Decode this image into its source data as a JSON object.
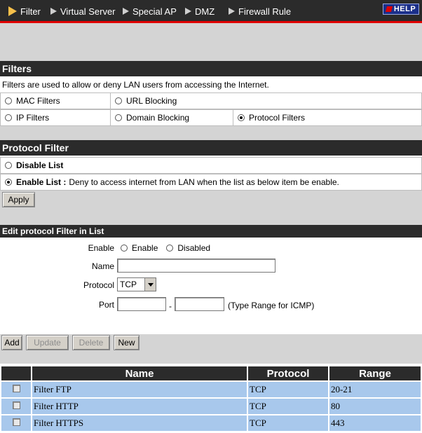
{
  "nav": {
    "items": [
      {
        "label": "Filter"
      },
      {
        "label": "Virtual Server"
      },
      {
        "label": "Special AP"
      },
      {
        "label": "DMZ"
      },
      {
        "label": "Firewall Rule"
      }
    ],
    "help": "HELP"
  },
  "filters": {
    "title": "Filters",
    "description": "Filters are used to allow or deny LAN users from accessing the Internet.",
    "options": {
      "mac": "MAC Filters",
      "url": "URL Blocking",
      "ip": "IP Filters",
      "domain": "Domain Blocking",
      "protocol": "Protocol Filters"
    },
    "selected": "Protocol Filters"
  },
  "protocol_filter": {
    "title": "Protocol Filter",
    "disable_label": "Disable List",
    "enable_label": "Enable List :",
    "enable_desc": "Deny to access internet from LAN when the list as below item be enable.",
    "selected": "Enable List",
    "apply": "Apply"
  },
  "edit": {
    "title": "Edit protocol Filter in List",
    "enable_label": "Enable",
    "enable_option": "Enable",
    "disabled_option": "Disabled",
    "name_label": "Name",
    "name_value": "",
    "protocol_label": "Protocol",
    "protocol_value": "TCP",
    "port_label": "Port",
    "port_from": "",
    "port_to": "",
    "port_sep": "-",
    "port_hint": "(Type Range for ICMP)"
  },
  "actions": {
    "add": "Add",
    "update": "Update",
    "delete": "Delete",
    "new": "New"
  },
  "table": {
    "headers": {
      "name": "Name",
      "protocol": "Protocol",
      "range": "Range"
    },
    "rows": [
      {
        "name": "Filter FTP",
        "protocol": "TCP",
        "range": "20-21"
      },
      {
        "name": "Filter HTTP",
        "protocol": "TCP",
        "range": "80"
      },
      {
        "name": "Filter HTTPS",
        "protocol": "TCP",
        "range": "443"
      }
    ]
  },
  "colors": {
    "header_bar": "#2b2b2b",
    "accent_red": "#e00000",
    "row_blue": "#a8c8ec",
    "panel_grey": "#d4d4d4"
  }
}
